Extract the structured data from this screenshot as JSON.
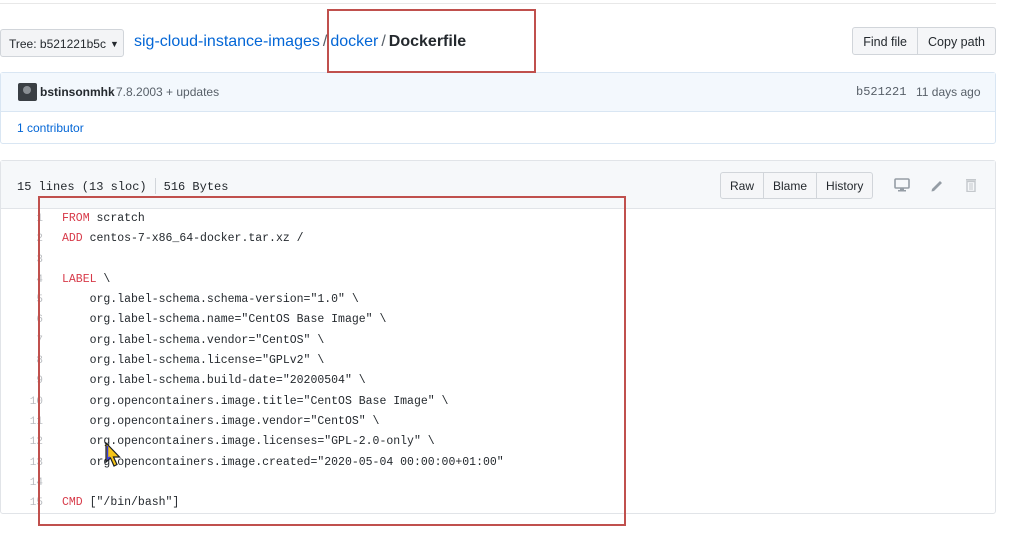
{
  "breadcrumb": {
    "tree_button": "Tree: b521221b5c",
    "repo": "sig-cloud-instance-images",
    "sep": "/",
    "folder": "docker",
    "file": "Dockerfile"
  },
  "actions": {
    "find_file": "Find file",
    "copy_path": "Copy path"
  },
  "commit": {
    "author": "bstinsonmhk",
    "message": "7.8.2003 + updates",
    "sha": "b521221",
    "date": "11 days ago",
    "contributors": "1 contributor"
  },
  "file": {
    "lines_info": "15 lines (13 sloc)",
    "size": "516 Bytes",
    "raw": "Raw",
    "blame": "Blame",
    "history": "History"
  },
  "code_lines": [
    {
      "n": "1",
      "kw": "FROM",
      "rest": " scratch"
    },
    {
      "n": "2",
      "kw": "ADD",
      "rest": " centos-7-x86_64-docker.tar.xz /"
    },
    {
      "n": "3",
      "kw": "",
      "rest": ""
    },
    {
      "n": "4",
      "kw": "LABEL",
      "rest": " \\"
    },
    {
      "n": "5",
      "kw": "",
      "rest": "    org.label-schema.schema-version=\"1.0\" \\"
    },
    {
      "n": "6",
      "kw": "",
      "rest": "    org.label-schema.name=\"CentOS Base Image\" \\"
    },
    {
      "n": "7",
      "kw": "",
      "rest": "    org.label-schema.vendor=\"CentOS\" \\"
    },
    {
      "n": "8",
      "kw": "",
      "rest": "    org.label-schema.license=\"GPLv2\" \\"
    },
    {
      "n": "9",
      "kw": "",
      "rest": "    org.label-schema.build-date=\"20200504\" \\"
    },
    {
      "n": "10",
      "kw": "",
      "rest": "    org.opencontainers.image.title=\"CentOS Base Image\" \\"
    },
    {
      "n": "11",
      "kw": "",
      "rest": "    org.opencontainers.image.vendor=\"CentOS\" \\"
    },
    {
      "n": "12",
      "kw": "",
      "rest": "    org.opencontainers.image.licenses=\"GPL-2.0-only\" \\"
    },
    {
      "n": "13",
      "kw": "",
      "rest": "    org.opencontainers.image.created=\"2020-05-04 00:00:00+01:00\""
    },
    {
      "n": "14",
      "kw": "",
      "rest": ""
    },
    {
      "n": "15",
      "kw": "CMD",
      "rest": " [\"/bin/bash\"]"
    }
  ],
  "colors": {
    "link": "#0366d6",
    "keyword": "#d73a49",
    "annotation": "#c0504d"
  }
}
